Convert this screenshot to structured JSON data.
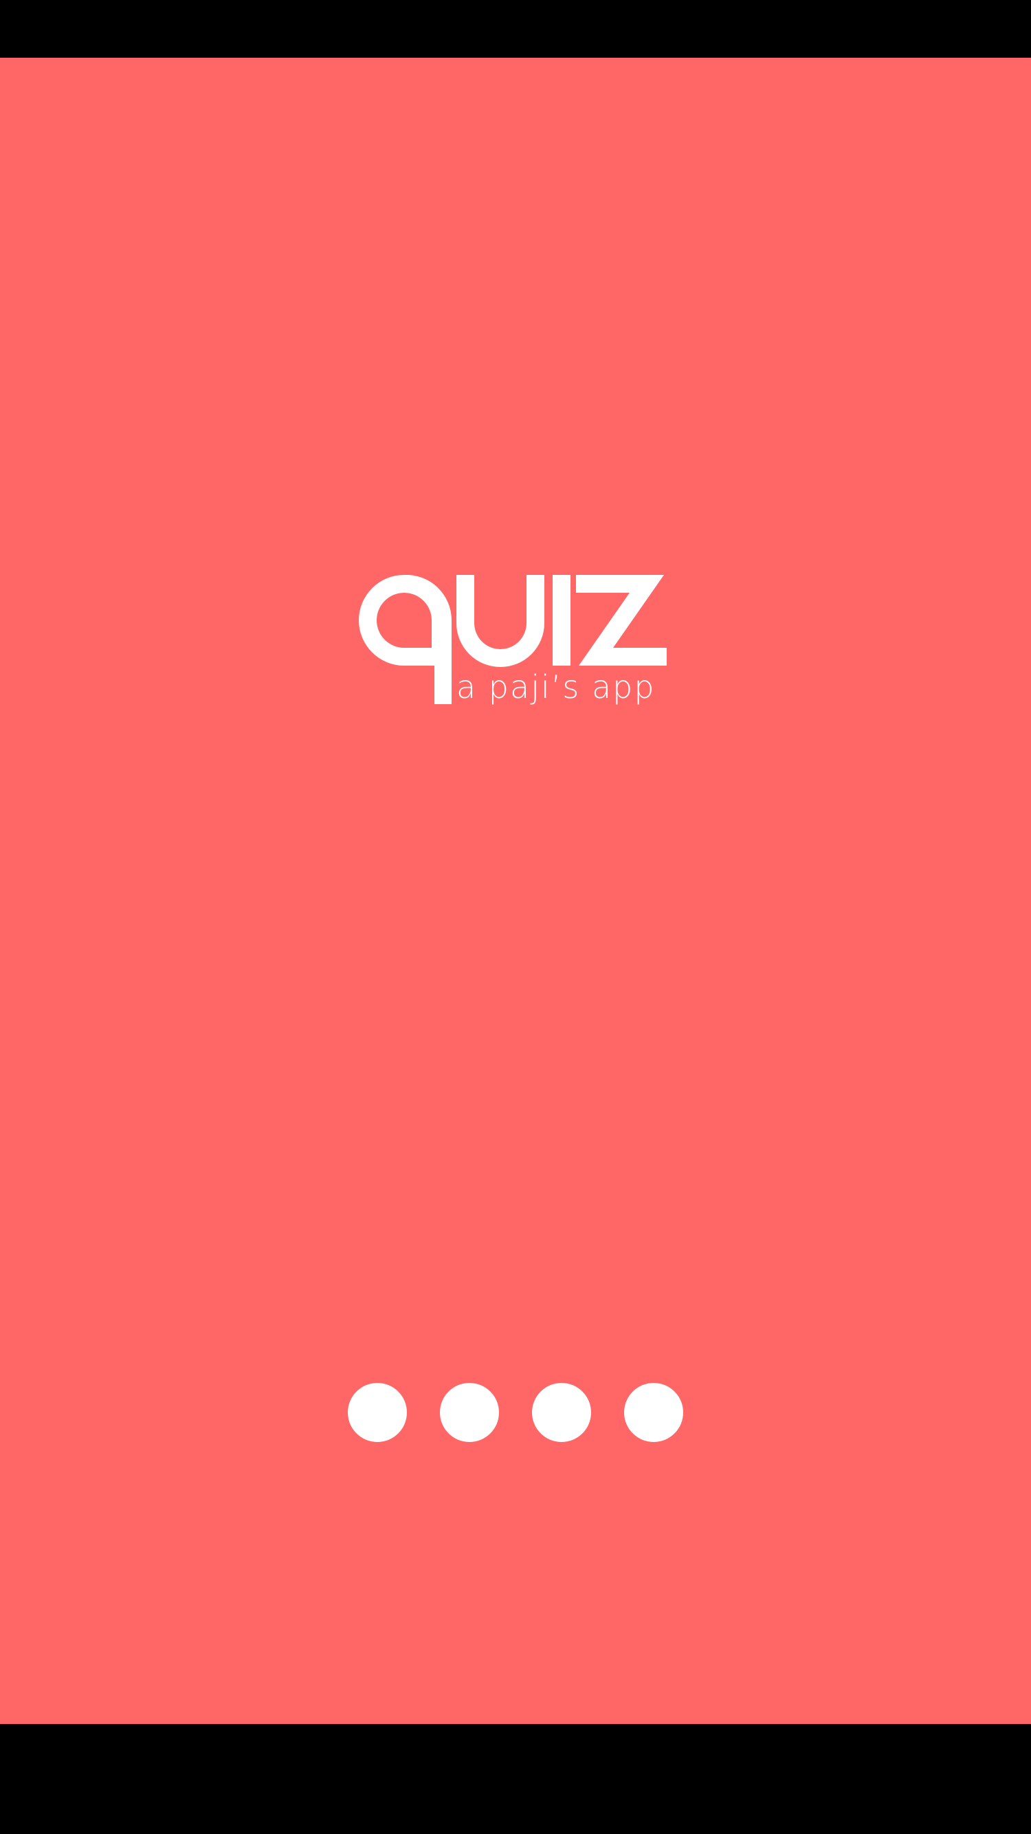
{
  "app": {
    "logo_text": "quiz",
    "tagline": "a paji’s app"
  },
  "loader": {
    "dots": 4,
    "label": ""
  },
  "colors": {
    "background": "#FF6666",
    "foreground": "#FFFFFF",
    "system_bars": "#000000"
  },
  "icons": {
    "logo": "quiz-logo",
    "loader": "loading-dots-icon"
  }
}
